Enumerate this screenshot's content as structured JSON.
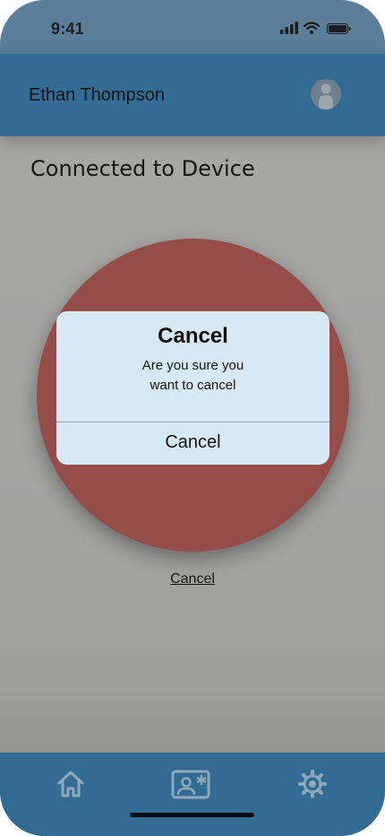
{
  "status_bar": {
    "time": "9:41",
    "icons": [
      "cellular-signal-icon",
      "wifi-icon",
      "battery-icon"
    ]
  },
  "header": {
    "user_name": "Ethan Thompson",
    "avatar_icon": "user-avatar-icon"
  },
  "page": {
    "title": "Connected to Device"
  },
  "dialog": {
    "title": "Cancel",
    "message_line1": "Are you sure you",
    "message_line2": "want to cancel",
    "button_label": "Cancel"
  },
  "cancel_link": {
    "label": "Cancel"
  },
  "tabbar": {
    "items": [
      {
        "icon": "home-icon"
      },
      {
        "icon": "contact-card-icon"
      },
      {
        "icon": "settings-gear-icon"
      }
    ]
  },
  "colors": {
    "header": "#336c92",
    "status_bar": "#5b7f9a",
    "background_dimmed": "#a6a6a5",
    "circle": "#944d49",
    "dialog": "#d6e9f5",
    "tab_icons": "#8da9bd"
  }
}
